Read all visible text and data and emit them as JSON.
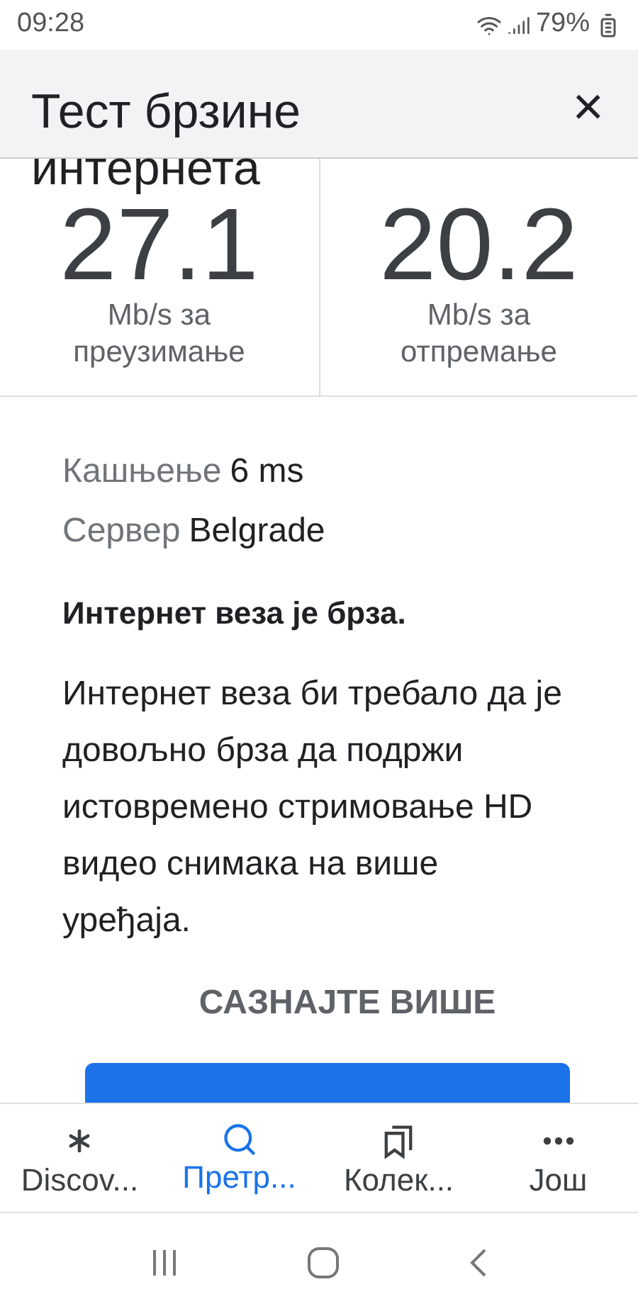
{
  "status_bar": {
    "time": "09:28",
    "battery": "79%"
  },
  "header": {
    "title": "Тест брзине интернета",
    "close": "×"
  },
  "results": [
    {
      "value": "27.1",
      "label": "Mb/s за преузимање"
    },
    {
      "value": "20.2",
      "label": "Mb/s за отпремање"
    }
  ],
  "details": [
    {
      "label": "Кашњење",
      "value": "6 ms"
    },
    {
      "label": "Сервер",
      "value": "Belgrade"
    }
  ],
  "summary": "Интернет веза је брза.",
  "description": "Интернет веза би требало да је довољно брза да подржи истовремено стримовање HD видео снимака на више уређаја.",
  "learn_more": "САЗНАЈТЕ ВИШЕ",
  "bottom_nav": [
    {
      "kind": "discover",
      "label": "Discov...",
      "selected": false
    },
    {
      "kind": "search",
      "label": "Претр...",
      "selected": true
    },
    {
      "kind": "collections",
      "label": "Колек...",
      "selected": false
    },
    {
      "kind": "more",
      "label": "Још",
      "selected": false
    }
  ]
}
